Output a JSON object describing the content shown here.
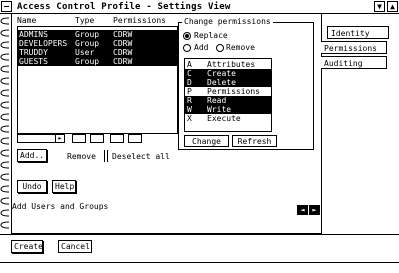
{
  "window": {
    "title": "Access Control Profile - Settings View",
    "minimize_label": "▼",
    "maximize_label": "▲"
  },
  "tabs": {
    "items": [
      {
        "label": "Identity"
      },
      {
        "label": "Permissions"
      },
      {
        "label": "Auditing"
      }
    ],
    "active_index": 1
  },
  "list": {
    "headers": {
      "name": "Name",
      "type": "Type",
      "permissions": "Permissions"
    },
    "rows": [
      {
        "name": "ADMINS",
        "type": "Group",
        "permissions": "CDRW",
        "selected": true
      },
      {
        "name": "DEVELOPERS",
        "type": "Group",
        "permissions": "CDRW",
        "selected": true
      },
      {
        "name": "TRUDDY",
        "type": "User",
        "permissions": "CDRW",
        "selected": true
      },
      {
        "name": "GUESTS",
        "type": "Group",
        "permissions": "CDRW",
        "selected": true
      }
    ]
  },
  "list_actions": {
    "add_label": "Add...",
    "remove_label": "Remove",
    "deselect_label": "Deselect all"
  },
  "undo_label": "Undo",
  "help_label": "Help",
  "change_permissions": {
    "group_label": "Change permissions",
    "replace_label": "Replace",
    "add_label": "Add",
    "remove_label": "Remove",
    "attributes": [
      {
        "key": "A",
        "label": "Attributes",
        "selected": false
      },
      {
        "key": "C",
        "label": "Create",
        "selected": true
      },
      {
        "key": "D",
        "label": "Delete",
        "selected": true
      },
      {
        "key": "P",
        "label": "Permissions",
        "selected": false
      },
      {
        "key": "R",
        "label": "Read",
        "selected": true
      },
      {
        "key": "W",
        "label": "Write",
        "selected": true
      },
      {
        "key": "X",
        "label": "Execute",
        "selected": false
      }
    ],
    "change_label": "Change",
    "refresh_label": "Refresh"
  },
  "status_text": "Add Users and Groups",
  "paging": {
    "prev_label": "◄",
    "next_label": "►"
  },
  "dialog": {
    "create_label": "Create",
    "cancel_label": "Cancel"
  }
}
